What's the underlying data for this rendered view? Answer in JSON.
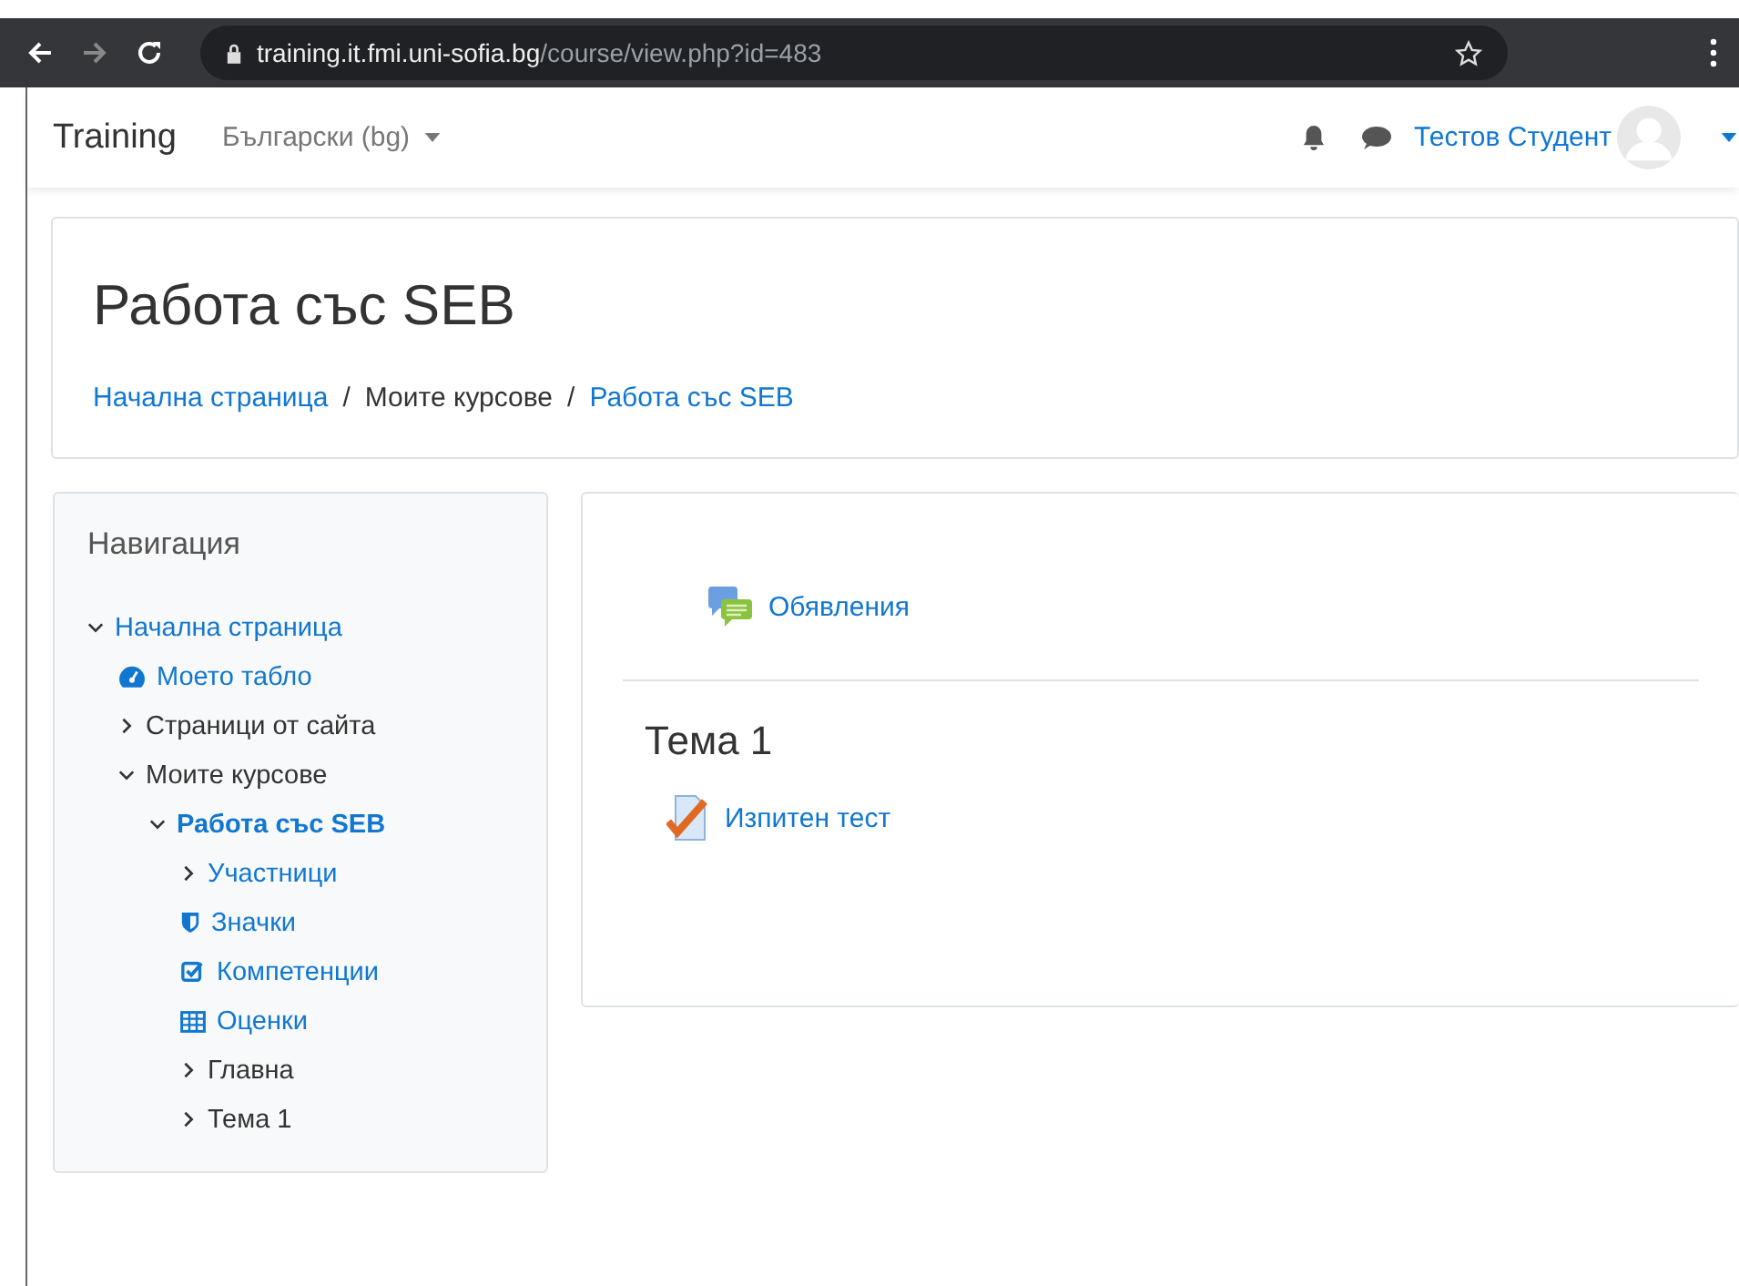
{
  "browser": {
    "url_host": "training.it.fmi.uni-sofia.bg",
    "url_path": "/course/view.php?id=483"
  },
  "navbar": {
    "brand": "Training",
    "language": "Български (bg)",
    "user_name": "Тестов Студент"
  },
  "header": {
    "title": "Работа със SEB",
    "separator": "/",
    "breadcrumb": [
      {
        "label": "Начална страница",
        "link": true
      },
      {
        "label": "Моите курсове",
        "link": false
      },
      {
        "label": "Работа със SEB",
        "link": true
      }
    ]
  },
  "navigation": {
    "title": "Навигация",
    "items": [
      {
        "label": "Начална страница",
        "kind": "branch",
        "expanded": true,
        "link": true,
        "selected": false,
        "children": [
          {
            "label": "Моето табло",
            "kind": "dashboard",
            "link": true,
            "selected": false
          },
          {
            "label": "Страници от сайта",
            "kind": "branch",
            "expanded": false,
            "link": false,
            "selected": false
          },
          {
            "label": "Моите курсове",
            "kind": "branch",
            "expanded": true,
            "link": false,
            "selected": false,
            "children": [
              {
                "label": "Работа със SEB",
                "kind": "branch",
                "expanded": true,
                "link": true,
                "selected": true,
                "children": [
                  {
                    "label": "Участници",
                    "kind": "branch",
                    "expanded": false,
                    "link": true,
                    "selected": false
                  },
                  {
                    "label": "Значки",
                    "kind": "badge",
                    "link": true,
                    "selected": false
                  },
                  {
                    "label": "Компетенции",
                    "kind": "check",
                    "link": true,
                    "selected": false
                  },
                  {
                    "label": "Оценки",
                    "kind": "table",
                    "link": true,
                    "selected": false
                  },
                  {
                    "label": "Главна",
                    "kind": "branch",
                    "expanded": false,
                    "link": false,
                    "selected": false
                  },
                  {
                    "label": "Тема 1",
                    "kind": "branch",
                    "expanded": false,
                    "link": false,
                    "selected": false
                  }
                ]
              }
            ]
          }
        ]
      }
    ]
  },
  "course": {
    "sections": [
      {
        "activities": [
          {
            "label": "Обявления",
            "kind": "forum"
          }
        ]
      },
      {
        "title": "Тема 1",
        "activities": [
          {
            "label": "Изпитен тест",
            "kind": "quiz"
          }
        ]
      }
    ]
  }
}
